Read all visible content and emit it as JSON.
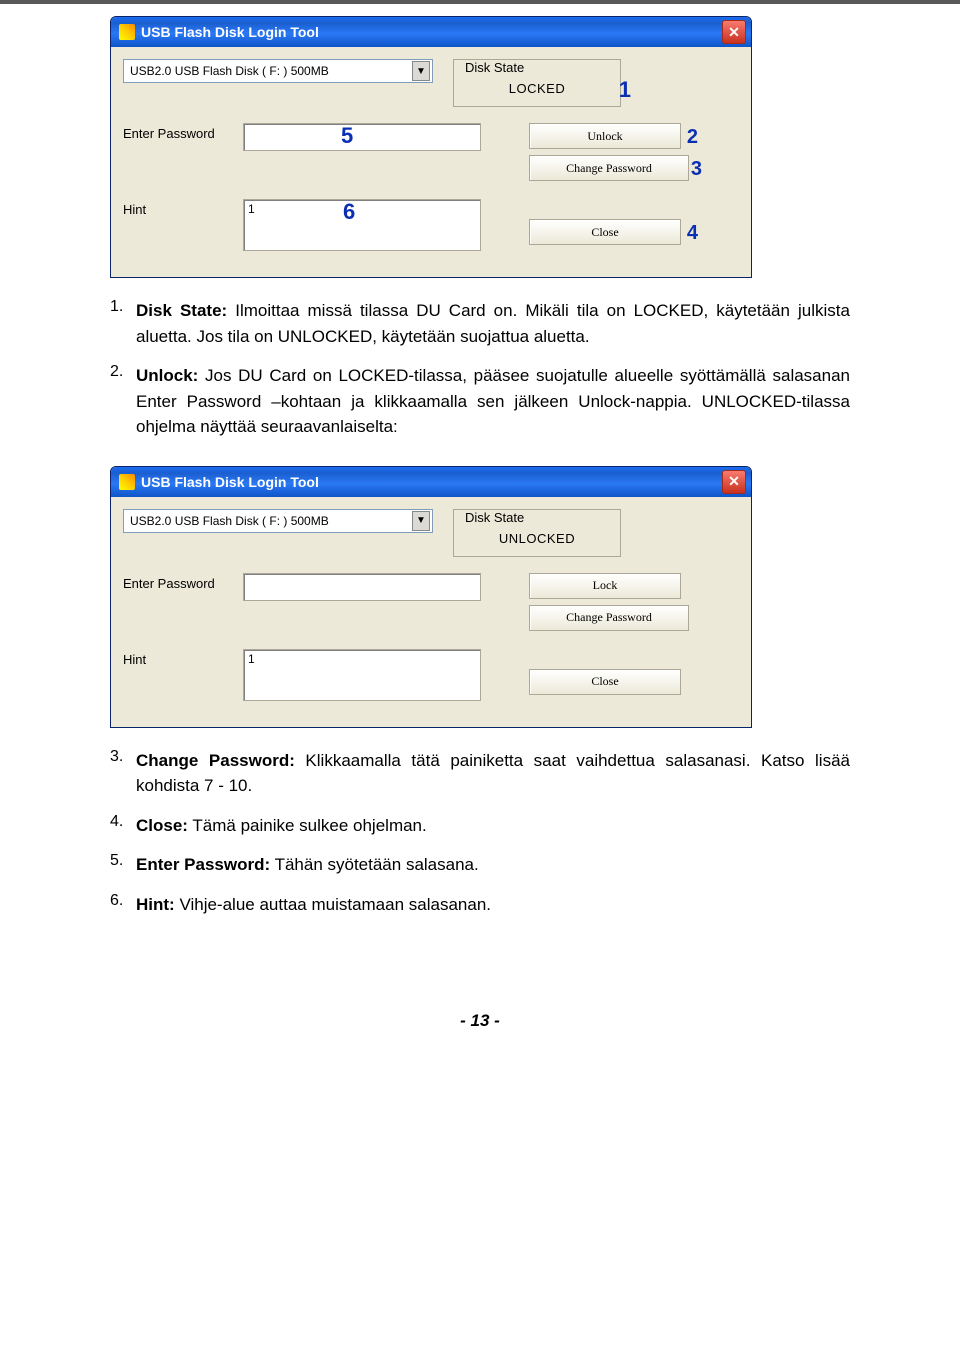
{
  "window": {
    "title": "USB Flash Disk Login Tool",
    "dropdown_value": "USB2.0   USB Flash Disk  ( F: )       500MB",
    "disk_state_label": "Disk State",
    "enter_password_label": "Enter Password",
    "hint_label": "Hint",
    "hint_value": "1",
    "close_button": "Close",
    "change_password_button": "Change Password"
  },
  "shot1": {
    "state_value": "LOCKED",
    "unlock_button": "Unlock",
    "ann": {
      "state": "1",
      "unlock": "2",
      "changepw": "3",
      "close": "4",
      "pw": "5",
      "hint": "6"
    }
  },
  "shot2": {
    "state_value": "UNLOCKED",
    "lock_button": "Lock"
  },
  "text": {
    "item1_num": "1.",
    "item1_label": "Disk State:",
    "item1_body": " Ilmoittaa missä tilassa DU Card on. Mikäli tila on LOCKED, käytetään julkista aluetta. Jos tila on UNLOCKED, käytetään suojattua aluetta.",
    "item2_num": "2.",
    "item2_label": "Unlock:",
    "item2_body": " Jos DU Card on LOCKED-tilassa, pääsee suojatulle alueelle syöttämällä salasanan Enter Password –kohtaan ja klikkaamalla sen jälkeen Unlock-nappia. UNLOCKED-tilassa ohjelma näyttää seuraavanlaiselta:",
    "item3_num": "3.",
    "item3_label": "Change Password:",
    "item3_body": " Klikkaamalla tätä painiketta saat vaihdettua salasanasi. Katso lisää kohdista 7 - 10.",
    "item4_num": "4.",
    "item4_label": "Close:",
    "item4_body": " Tämä painike sulkee ohjelman.",
    "item5_num": "5.",
    "item5_label": "Enter Password:",
    "item5_body": " Tähän syötetään salasana.",
    "item6_num": "6.",
    "item6_label": "Hint:",
    "item6_body": " Vihje-alue auttaa muistamaan salasanan.",
    "page_number": "- 13 -"
  }
}
